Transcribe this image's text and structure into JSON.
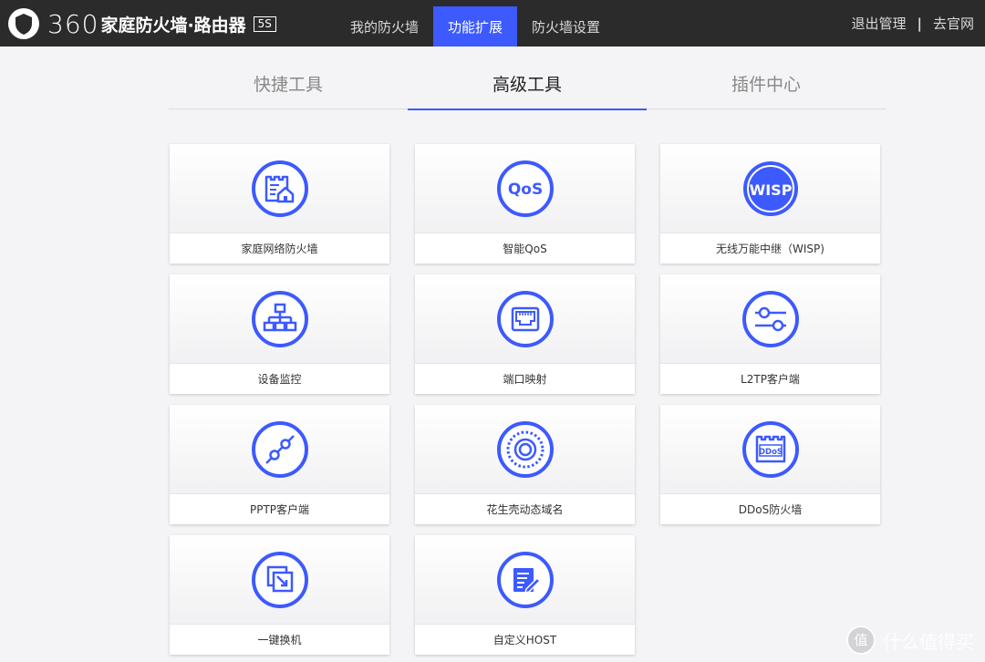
{
  "brand": {
    "logo_num": "360",
    "logo_cn": "家庭防火墙·路由器",
    "model_badge": "5S"
  },
  "topnav": {
    "items": [
      {
        "label": "我的防火墙"
      },
      {
        "label": "功能扩展"
      },
      {
        "label": "防火墙设置"
      }
    ],
    "active_index": 1
  },
  "topright": {
    "logout_label": "退出管理",
    "separator": "|",
    "official_site_label": "去官网"
  },
  "subtabs": {
    "items": [
      {
        "label": "快捷工具"
      },
      {
        "label": "高级工具"
      },
      {
        "label": "插件中心"
      }
    ],
    "active_index": 1
  },
  "tools": [
    {
      "label": "家庭网络防火墙",
      "icon": "home-firewall-icon"
    },
    {
      "label": "智能QoS",
      "icon": "qos-icon",
      "icon_text": "QoS"
    },
    {
      "label": "无线万能中继（WISP)",
      "icon": "wisp-icon",
      "icon_text": "WISP"
    },
    {
      "label": "设备监控",
      "icon": "network-topology-icon"
    },
    {
      "label": "端口映射",
      "icon": "ethernet-port-icon"
    },
    {
      "label": "L2TP客户端",
      "icon": "sliders-icon"
    },
    {
      "label": "PPTP客户端",
      "icon": "link-icon"
    },
    {
      "label": "花生壳动态域名",
      "icon": "dynamic-dns-icon"
    },
    {
      "label": "DDoS防火墙",
      "icon": "ddos-firewall-icon",
      "icon_text": "DDoS"
    },
    {
      "label": "一键换机",
      "icon": "migrate-icon"
    },
    {
      "label": "自定义HOST",
      "icon": "edit-document-icon"
    }
  ],
  "watermark": {
    "circle_text": "值",
    "text": "什么值得买"
  },
  "colors": {
    "accent": "#3d5afe",
    "topbar": "#2b2b2b",
    "background": "#f4f4f6"
  }
}
